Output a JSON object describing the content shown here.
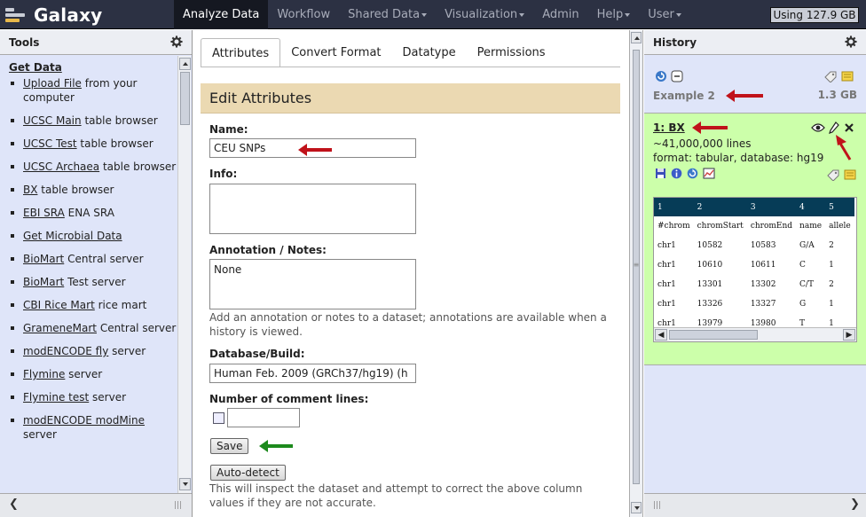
{
  "masthead": {
    "brand": "Galaxy",
    "tabs": [
      {
        "label": "Analyze Data",
        "active": true,
        "dropdown": false
      },
      {
        "label": "Workflow",
        "active": false,
        "dropdown": false
      },
      {
        "label": "Shared Data",
        "active": false,
        "dropdown": true
      },
      {
        "label": "Visualization",
        "active": false,
        "dropdown": true
      },
      {
        "label": "Admin",
        "active": false,
        "dropdown": false
      },
      {
        "label": "Help",
        "active": false,
        "dropdown": true
      },
      {
        "label": "User",
        "active": false,
        "dropdown": true
      }
    ],
    "quota": "Using 127.9 GB"
  },
  "tools": {
    "title": "Tools",
    "section": "Get Data",
    "items": [
      {
        "link": "Upload File",
        "rest": " from your computer"
      },
      {
        "link": "UCSC Main",
        "rest": " table browser"
      },
      {
        "link": "UCSC Test",
        "rest": " table browser"
      },
      {
        "link": "UCSC Archaea",
        "rest": " table browser"
      },
      {
        "link": "BX",
        "rest": " table browser"
      },
      {
        "link": "EBI SRA",
        "rest": " ENA SRA"
      },
      {
        "link": "Get Microbial Data",
        "rest": ""
      },
      {
        "link": "BioMart",
        "rest": " Central server"
      },
      {
        "link": "BioMart",
        "rest": " Test server"
      },
      {
        "link": "CBI Rice Mart",
        "rest": " rice mart"
      },
      {
        "link": "GrameneMart",
        "rest": " Central server"
      },
      {
        "link": "modENCODE fly",
        "rest": " server"
      },
      {
        "link": "Flymine",
        "rest": " server"
      },
      {
        "link": "Flymine test",
        "rest": " server"
      },
      {
        "link": "modENCODE modMine",
        "rest": " server"
      }
    ]
  },
  "center": {
    "tabs": [
      "Attributes",
      "Convert Format",
      "Datatype",
      "Permissions"
    ],
    "header": "Edit Attributes",
    "name_label": "Name:",
    "name_value": "CEU SNPs",
    "info_label": "Info:",
    "info_value": "",
    "annotation_label": "Annotation / Notes:",
    "annotation_value": "None",
    "annotation_help": "Add an annotation or notes to a dataset; annotations are available when a history is viewed.",
    "dbkey_label": "Database/Build:",
    "dbkey_value": "Human Feb. 2009 (GRCh37/hg19) (h",
    "comment_label": "Number of comment lines:",
    "comment_value": "",
    "save_label": "Save",
    "autodetect_label": "Auto-detect",
    "autodetect_help": "This will inspect the dataset and attempt to correct the above column values if they are not accurate."
  },
  "history": {
    "title": "History",
    "name": "Example 2",
    "size": "1.3 GB",
    "dataset": {
      "title": "1: BX",
      "lines": "~41,000,000 lines",
      "format": "format: tabular, database: hg19",
      "peek_header": [
        "1",
        "2",
        "3",
        "4",
        "5"
      ],
      "peek_rows": [
        [
          "#chrom",
          "chromStart",
          "chromEnd",
          "name",
          "allele"
        ],
        [
          "chr1",
          "10582",
          "10583",
          "G/A",
          "2"
        ],
        [
          "chr1",
          "10610",
          "10611",
          "C",
          "1"
        ],
        [
          "chr1",
          "13301",
          "13302",
          "C/T",
          "2"
        ],
        [
          "chr1",
          "13326",
          "13327",
          "G",
          "1"
        ],
        [
          "chr1",
          "13979",
          "13980",
          "T",
          "1"
        ]
      ]
    }
  },
  "colors": {
    "masthead": "#2c3143",
    "panel": "#dfe5f9",
    "dataset_ok": "#ccffaa",
    "section_header": "#ebd9b2",
    "annotation_arrow": "#c0121a",
    "save_arrow": "#1d8a1d"
  }
}
